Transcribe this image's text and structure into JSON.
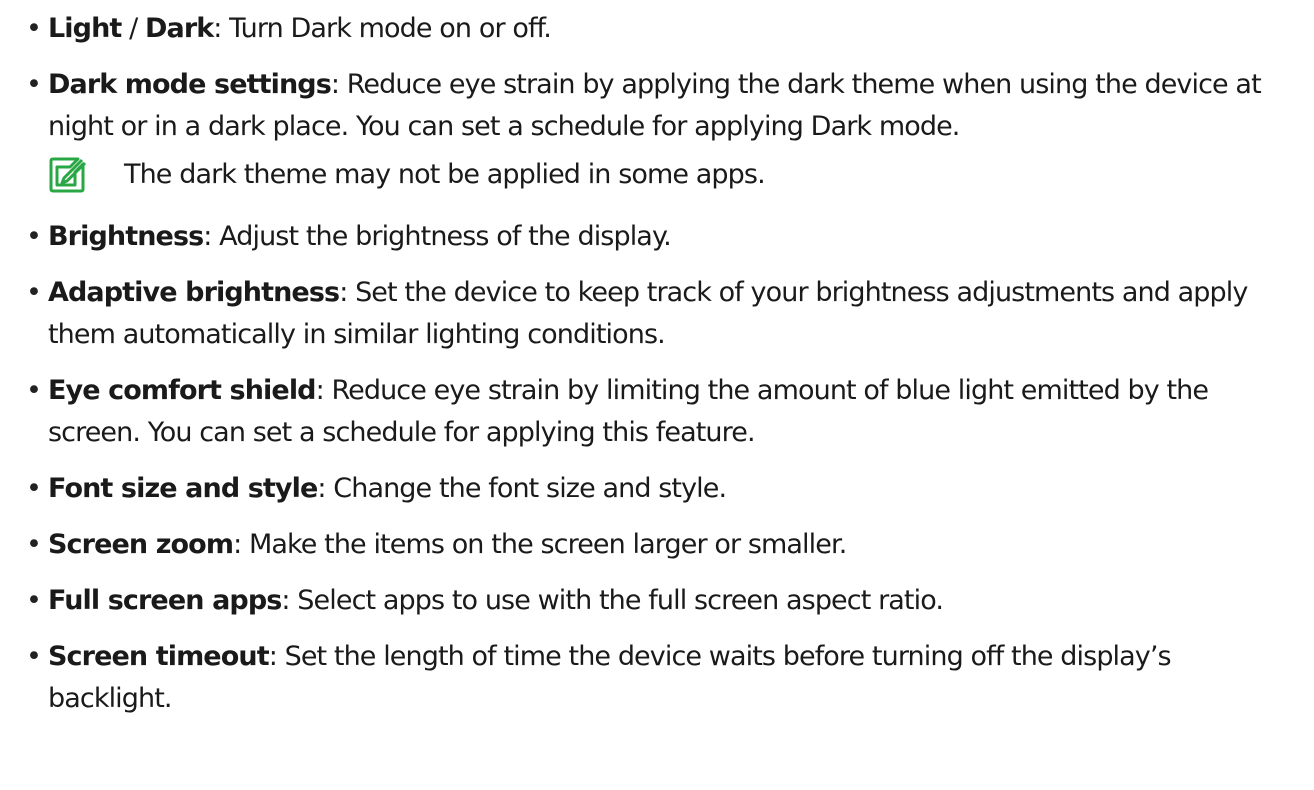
{
  "items_before_note": [
    {
      "term": "Light",
      "sep": " / ",
      "term2": "Dark",
      "desc": ": Turn Dark mode on or off."
    },
    {
      "term": "Dark mode settings",
      "desc": ": Reduce eye strain by applying the dark theme when using the device at night or in a dark place. You can set a schedule for applying Dark mode."
    }
  ],
  "note": {
    "icon": "note-pencil-icon",
    "text": "The dark theme may not be applied in some apps.",
    "icon_color": "#2aa745"
  },
  "items_after_note": [
    {
      "term": "Brightness",
      "desc": ": Adjust the brightness of the display."
    },
    {
      "term": "Adaptive brightness",
      "desc": ": Set the device to keep track of your brightness adjustments and apply them automatically in similar lighting conditions."
    },
    {
      "term": "Eye comfort shield",
      "desc": ": Reduce eye strain by limiting the amount of blue light emitted by the screen. You can set a schedule for applying this feature."
    },
    {
      "term": "Font size and style",
      "desc": ": Change the font size and style."
    },
    {
      "term": "Screen zoom",
      "desc": ": Make the items on the screen larger or smaller."
    },
    {
      "term": "Full screen apps",
      "desc": ": Select apps to use with the full screen aspect ratio."
    },
    {
      "term": "Screen timeout",
      "desc": ": Set the length of time the device waits before turning off the display’s backlight."
    }
  ]
}
